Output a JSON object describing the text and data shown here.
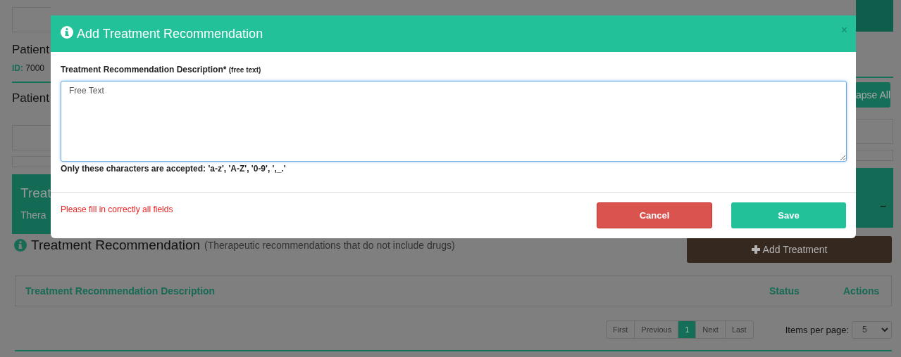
{
  "background_page": {
    "left": {
      "patient_title": "Patient",
      "id_label": "ID:",
      "id_value": "7000",
      "section_title": "Patient",
      "panel_title": "Treat",
      "panel_subtitle": "Thera"
    },
    "right": {
      "collapse_button": "apse All",
      "panel_toggle": "−"
    },
    "treatment_section": {
      "title": "Treatment Recommendation",
      "subtitle": "(Therapeutic recommendations that do not include drugs)",
      "add_button": "Add Treatment",
      "table": {
        "columns": [
          "Treatment Recommendation Description",
          "Status",
          "Actions"
        ]
      }
    },
    "pagination": {
      "pages": [
        {
          "label": "First",
          "selected": false
        },
        {
          "label": "Previous",
          "selected": false
        },
        {
          "label": "1",
          "selected": true
        },
        {
          "label": "Next",
          "selected": false
        },
        {
          "label": "Last",
          "selected": false
        }
      ]
    },
    "items_per_page": {
      "label": "Items per page:",
      "value": "5"
    }
  },
  "modal": {
    "title": "Add Treatment Recommendation",
    "close": "×",
    "field_label": "Treatment Recommendation Description*",
    "field_note": "(free text)",
    "field_value": "Free Text",
    "hint": "Only these characters are accepted: 'a-z', 'A-Z', '0-9', ',_.'",
    "error": "Please fill in correctly all fields",
    "buttons": [
      {
        "label": "Cancel",
        "kind": "cancel"
      },
      {
        "label": "Save",
        "kind": "save"
      }
    ]
  }
}
